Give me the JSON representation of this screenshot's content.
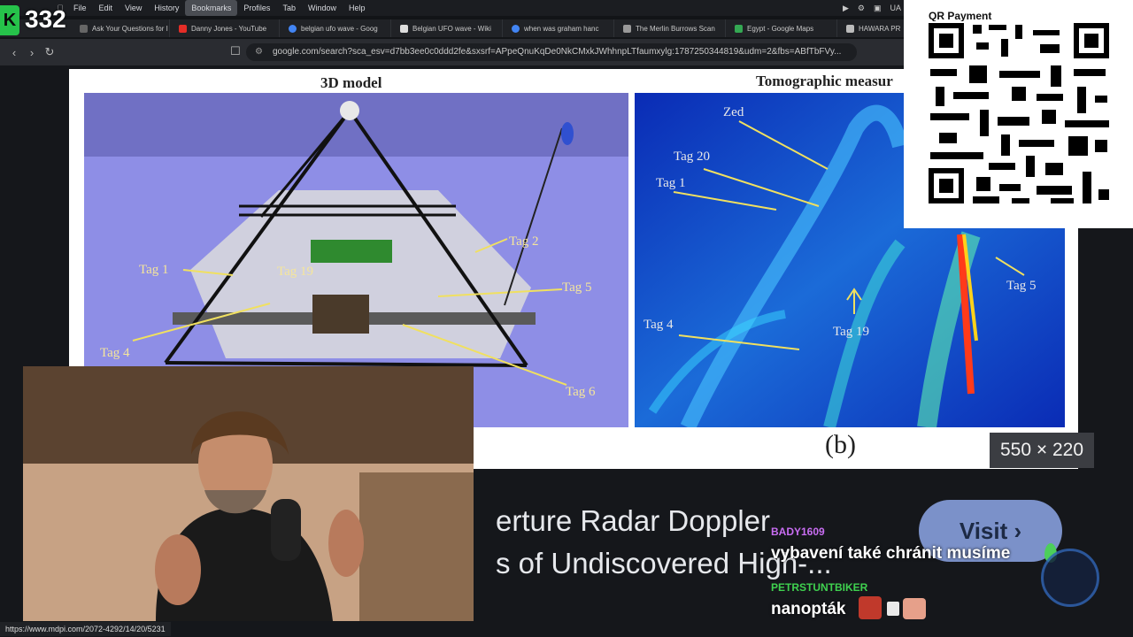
{
  "menubar": {
    "items": [
      "File",
      "Edit",
      "View",
      "History",
      "Bookmarks",
      "Profiles",
      "Tab",
      "Window",
      "Help"
    ],
    "active_index": 4,
    "right_label": "UA"
  },
  "tabs": [
    {
      "label": "Ask Your Questions for I",
      "color": "#666"
    },
    {
      "label": "Danny Jones - YouTube",
      "color": "#e52d27"
    },
    {
      "label": "belgian ufo wave - Goog",
      "color": "#4285f4"
    },
    {
      "label": "Belgian UFO wave - Wiki",
      "color": "#dddddd"
    },
    {
      "label": "when was graham hanc",
      "color": "#4285f4"
    },
    {
      "label": "The Merlin Burrows Scan",
      "color": "#999999"
    },
    {
      "label": "Egypt - Google Maps",
      "color": "#34a853"
    },
    {
      "label": "HAWARA PR",
      "color": "#bbbbbb"
    }
  ],
  "browser": {
    "url": "google.com/search?sca_esv=d7bb3ee0c0ddd2fe&sxsrf=APpeQnuKqDe0NkCMxkJWhhnpLTfaumxylg:1787250344819&udm=2&fbs=ABfTbFVy..."
  },
  "overlay": {
    "viewer_count": "332",
    "logo_letter": "K"
  },
  "figure": {
    "left_caption": "3D model",
    "right_caption": "Tomographic measur",
    "sub_label": "(b)",
    "left_tags": [
      "Tag 1",
      "Tag 19",
      "Tag 2",
      "Tag 5",
      "Tag 4",
      "Tag 6"
    ],
    "right_tags": [
      "Zed",
      "Tag 20",
      "Tag 1",
      "Tag 5",
      "Tag 4",
      "Tag 19"
    ],
    "size_badge": "550 × 220"
  },
  "result": {
    "title_line1": "erture Radar Doppler",
    "title_line2": "s of Undiscovered High-...",
    "visit_label": "Visit"
  },
  "qr": {
    "title": "QR Payment"
  },
  "chat": [
    {
      "user": "BADY1609",
      "user_color": "#c86df2",
      "message": "vybavení také chránit musíme"
    },
    {
      "user": "PETRSTUNTBIKER",
      "user_color": "#3fd14f",
      "message": "nanopták"
    }
  ],
  "status_bar": {
    "url": "https://www.mdpi.com/2072-4292/14/20/5231"
  }
}
